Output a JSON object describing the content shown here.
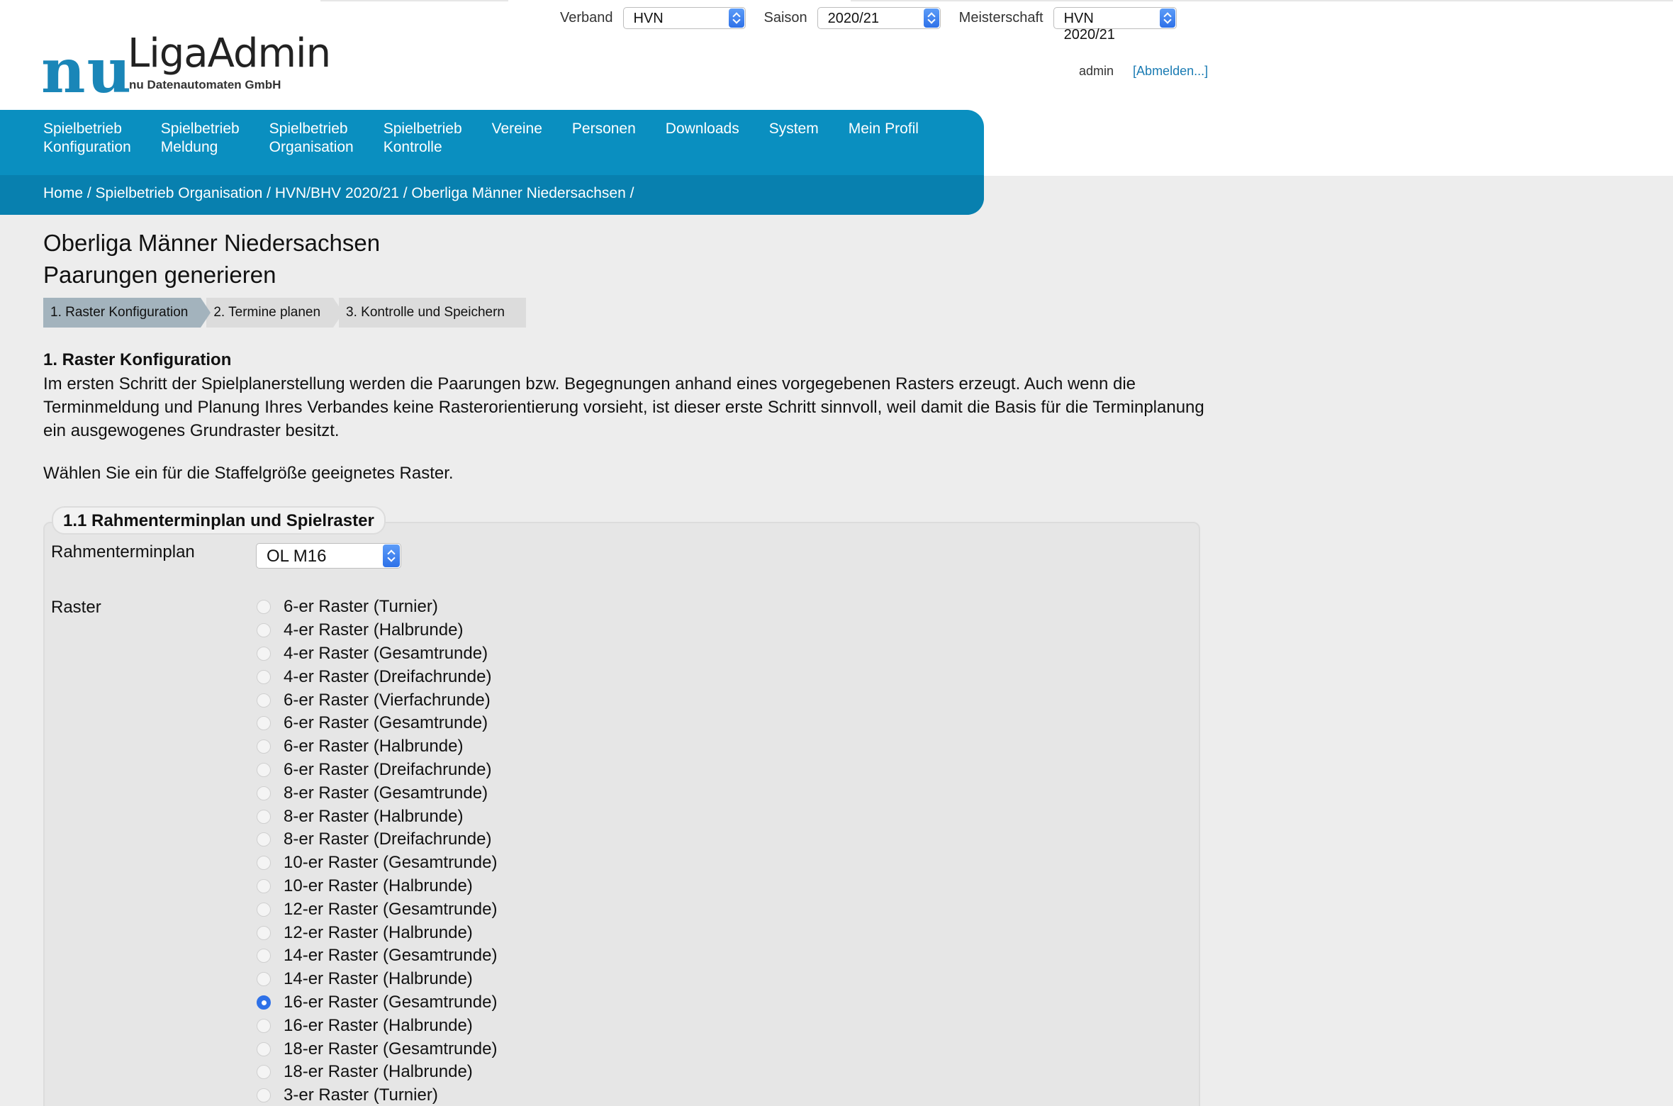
{
  "header": {
    "logo": {
      "nu": "nu",
      "product": "LigaAdmin",
      "company": "nu Datenautomaten GmbH"
    },
    "selectors": [
      {
        "label": "Verband",
        "value": "HVN"
      },
      {
        "label": "Saison",
        "value": "2020/21"
      },
      {
        "label": "Meisterschaft",
        "value": "HVN 2020/21"
      }
    ],
    "user": {
      "name": "admin",
      "logout": "[Abmelden...]"
    }
  },
  "nav": {
    "items": [
      {
        "label": "Spielbetrieb\nKonfiguration"
      },
      {
        "label": "Spielbetrieb\nMeldung"
      },
      {
        "label": "Spielbetrieb\nOrganisation",
        "active": true
      },
      {
        "label": "Spielbetrieb\nKontrolle"
      },
      {
        "label": "Vereine"
      },
      {
        "label": "Personen"
      },
      {
        "label": "Downloads"
      },
      {
        "label": "System"
      },
      {
        "label": "Mein Profil"
      }
    ],
    "breadcrumb": "Home / Spielbetrieb Organisation / HVN/BHV 2020/21 / Oberliga Männer Niedersachsen /"
  },
  "main": {
    "title_line1": "Oberliga Männer Niedersachsen",
    "title_line2": "Paarungen generieren",
    "steps": [
      {
        "label": "1. Raster Konfiguration",
        "active": true
      },
      {
        "label": "2. Termine planen"
      },
      {
        "label": "3. Kontrolle und Speichern"
      }
    ],
    "section_heading": "1. Raster Konfiguration",
    "intro": "Im ersten Schritt der Spielplanerstellung werden die Paarungen bzw. Begegnungen anhand eines vorgegebenen Rasters erzeugt. Auch wenn die Terminmeldung und Planung Ihres Verbandes keine Rasterorientierung vorsieht, ist dieser erste Schritt sinnvoll, weil damit die Basis für die Terminplanung ein ausgewogenes Grundraster besitzt.",
    "hint": "Wählen Sie ein für die Staffelgröße geeignetes Raster.",
    "fieldset": {
      "legend": "1.1 Rahmenterminplan und Spielraster",
      "plan_label": "Rahmenterminplan",
      "plan_value": "OL M16",
      "raster_label": "Raster",
      "options": [
        {
          "label": "6-er Raster (Turnier)",
          "checked": false
        },
        {
          "label": "4-er Raster (Halbrunde)",
          "checked": false
        },
        {
          "label": "4-er Raster (Gesamtrunde)",
          "checked": false
        },
        {
          "label": "4-er Raster (Dreifachrunde)",
          "checked": false
        },
        {
          "label": "6-er Raster (Vierfachrunde)",
          "checked": false
        },
        {
          "label": "6-er Raster (Gesamtrunde)",
          "checked": false
        },
        {
          "label": "6-er Raster (Halbrunde)",
          "checked": false
        },
        {
          "label": "6-er Raster (Dreifachrunde)",
          "checked": false
        },
        {
          "label": "8-er Raster (Gesamtrunde)",
          "checked": false
        },
        {
          "label": "8-er Raster (Halbrunde)",
          "checked": false
        },
        {
          "label": "8-er Raster (Dreifachrunde)",
          "checked": false
        },
        {
          "label": "10-er Raster (Gesamtrunde)",
          "checked": false
        },
        {
          "label": "10-er Raster (Halbrunde)",
          "checked": false
        },
        {
          "label": "12-er Raster (Gesamtrunde)",
          "checked": false
        },
        {
          "label": "12-er Raster (Halbrunde)",
          "checked": false
        },
        {
          "label": "14-er Raster (Gesamtrunde)",
          "checked": false
        },
        {
          "label": "14-er Raster (Halbrunde)",
          "checked": false
        },
        {
          "label": "16-er Raster (Gesamtrunde)",
          "checked": true
        },
        {
          "label": "16-er Raster (Halbrunde)",
          "checked": false
        },
        {
          "label": "18-er Raster (Gesamtrunde)",
          "checked": false
        },
        {
          "label": "18-er Raster (Halbrunde)",
          "checked": false
        },
        {
          "label": "3-er Raster (Turnier)",
          "checked": false
        }
      ]
    }
  }
}
